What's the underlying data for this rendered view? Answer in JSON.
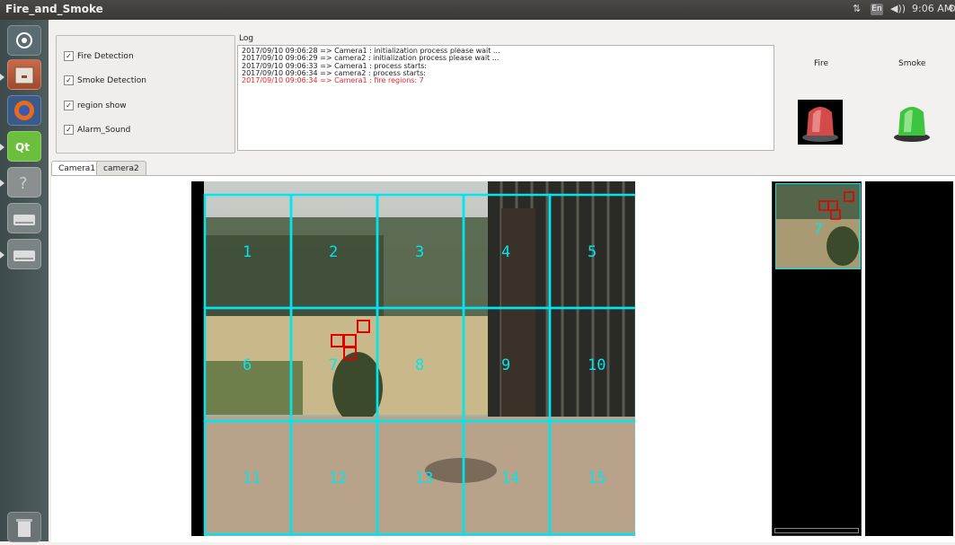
{
  "window": {
    "title": "Fire_and_Smoke"
  },
  "topbar": {
    "keyboard": "En",
    "volume": "◀))",
    "time": "9:06 AM"
  },
  "launcher": {
    "icons": [
      "ubuntu-dash-icon",
      "files-icon",
      "firefox-icon",
      "qt-creator-icon",
      "help-icon",
      "drive-icon",
      "drive-icon",
      "trash-icon"
    ]
  },
  "controls": {
    "items": [
      {
        "label": "Fire Detection",
        "checked": true
      },
      {
        "label": "Smoke Detection",
        "checked": true
      },
      {
        "label": "region show",
        "checked": true
      },
      {
        "label": "Alarm_Sound",
        "checked": true
      }
    ],
    "check_glyph": "✓"
  },
  "log": {
    "label": "Log",
    "lines": [
      {
        "text": "2017/09/10 09:06:28 => Camera1 : initialization process please wait ...",
        "color": "#222222"
      },
      {
        "text": "2017/09/10 09:06:29 => camera2 : initialization process please wait ...",
        "color": "#222222"
      },
      {
        "text": "2017/09/10 09:06:33 => Camera1 : process starts:",
        "color": "#222222"
      },
      {
        "text": "2017/09/10 09:06:34 => camera2 : process starts:",
        "color": "#222222"
      },
      {
        "text": "2017/09/10 09:06:34 => Camera1 :  fire regions: 7",
        "color": "#e8262b"
      }
    ]
  },
  "alarms": {
    "fire_label": "Fire",
    "smoke_label": "Smoke",
    "fire_color": "#d24a4a",
    "smoke_color": "#3fc43f"
  },
  "tabs": [
    {
      "label": "Camera1",
      "active": true
    },
    {
      "label": "camera2",
      "active": false
    }
  ],
  "video": {
    "grid_color": "#00e5ee",
    "region_labels": [
      "1",
      "2",
      "3",
      "4",
      "5",
      "6",
      "7",
      "8",
      "9",
      "10",
      "11",
      "12",
      "13",
      "14",
      "15"
    ],
    "fire_region": "7",
    "fire_box_color": "#e00000"
  },
  "thumbnail": {
    "region_label": "7"
  }
}
